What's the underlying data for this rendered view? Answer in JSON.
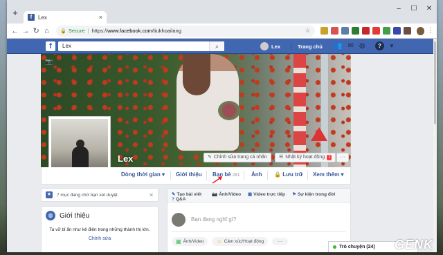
{
  "browser": {
    "tab_title": "Lex",
    "tab_close": "×",
    "new_tab": "+",
    "url_secure_label": "Secure",
    "url_scheme": "https://",
    "url_host": "www.facebook.com",
    "url_path": "/tiukhoailang",
    "window_controls": [
      "–",
      "☐",
      "✕"
    ]
  },
  "facebook": {
    "logo": "f",
    "search_value": "Lex",
    "user_name": "Lex",
    "home_label": "Trang chủ"
  },
  "profile": {
    "name": "Lex",
    "edit_cover_button": "Chỉnh sửa trang cá nhân",
    "activity_log_button": "Nhật ký hoạt động",
    "activity_log_badge": "7",
    "more_button": "···",
    "nav": {
      "timeline": "Dòng thời gian",
      "about": "Giới thiệu",
      "friends": "Bạn bè",
      "friends_count": "281",
      "photos": "Ảnh",
      "archive": "Lưu trữ",
      "more": "Xem thêm"
    }
  },
  "sidebar": {
    "pending_text": "7 mục đang chờ bạn xét duyệt",
    "intro_title": "Giới thiệu",
    "intro_text": "Ta vỡ bỉ ẩn như kẻ điên trong những thành thị lớn.",
    "intro_edit": "Chỉnh sửa"
  },
  "composer": {
    "tabs": [
      "Tạo bài viết",
      "Ảnh/Video",
      "Video trực tiếp",
      "Sự kiện trong đời",
      "Q&A"
    ],
    "placeholder": "Bạn đang nghĩ gì?",
    "actions": [
      "Ảnh/Video",
      "Cảm xúc/Hoạt động",
      "···"
    ]
  },
  "chat": {
    "label": "Trò chuyện (24)"
  },
  "watermark": "GENK",
  "colors": {
    "fb_blue": "#4267b2",
    "link_blue": "#365899",
    "secure_green": "#1e8e3e",
    "badge_red": "#fa3e3e"
  }
}
